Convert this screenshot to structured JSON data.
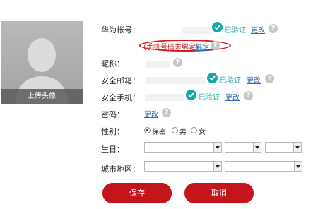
{
  "avatar": {
    "caption": "上传头像"
  },
  "form": {
    "account": {
      "label": "华为帐号：",
      "status": "已验证",
      "action": "更改",
      "help": "?"
    },
    "phone_notice": {
      "text": "(手机号码未绑定)",
      "action": "绑定",
      "help": "?"
    },
    "nickname": {
      "label": "昵称：",
      "help": "?"
    },
    "email": {
      "label": "安全邮箱：",
      "status": "已验证",
      "action": "更改",
      "help": "?"
    },
    "mobile": {
      "label": "安全手机：",
      "status": "已验证",
      "action": "更改",
      "help": "?"
    },
    "password": {
      "label": "密码：",
      "action": "更改",
      "help": "?"
    },
    "gender": {
      "label": "性别：",
      "options": [
        "保密",
        "男",
        "女"
      ],
      "selected": "保密"
    },
    "birthday": {
      "label": "生日：",
      "year": "",
      "month": "",
      "day": ""
    },
    "region": {
      "label": "城市地区：",
      "province": "",
      "city": ""
    }
  },
  "buttons": {
    "save": "保存",
    "cancel": "取消"
  },
  "colors": {
    "accent": "#c4151c",
    "verified": "#17a9a3",
    "link": "#2a6ab5",
    "notice": "#d11b1b"
  }
}
